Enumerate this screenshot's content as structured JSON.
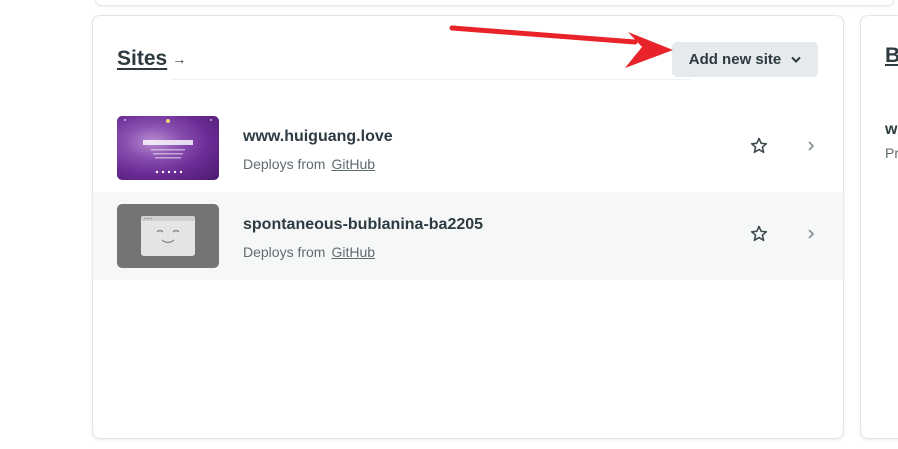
{
  "sites_card": {
    "title": "Sites",
    "title_arrow": "→",
    "add_button": "Add new site",
    "add_button_chevron": "▾"
  },
  "sites": [
    {
      "name": "www.huiguang.love",
      "deploys_label": "Deploys from",
      "provider": "GitHub",
      "thumb_text": "www.huiguang.love"
    },
    {
      "name": "spontaneous-bublanina-ba2205",
      "deploys_label": "Deploys from",
      "provider": "GitHub"
    }
  ],
  "side_card": {
    "title": "B",
    "item_name": "w",
    "item_sub": "Pr"
  },
  "colors": {
    "annotation_arrow": "#e8232a",
    "button_bg": "#e6eaed",
    "row_alt_bg": "#f6f8f8"
  }
}
